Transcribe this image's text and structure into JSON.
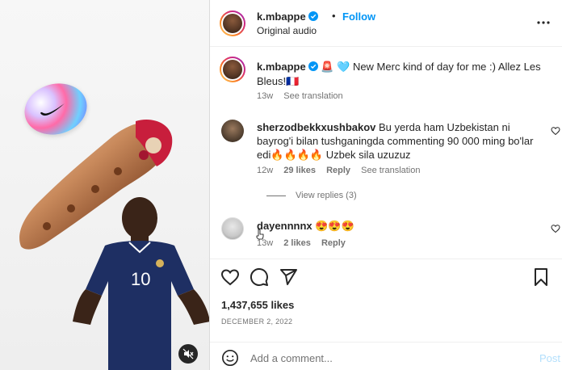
{
  "post": {
    "username": "k.mbappe",
    "follow_label": "Follow",
    "dot": "•",
    "audio_label": "Original audio",
    "more_icon": "more-horizontal-icon",
    "accent_color": "#0095f6"
  },
  "caption": {
    "username": "k.mbappe",
    "emojis": "🚨 🩵",
    "text": "New Merc kind of day for me :) Allez Les Bleus!🇫🇷",
    "age": "13w",
    "see_translation": "See translation"
  },
  "comments": [
    {
      "username": "sherzodbekkxushbakov",
      "text": "Bu yerda ham Uzbekistan ni bayrog'i bilan tushganingda commenting 90 000 ming bo'lar edi🔥🔥🔥🔥 Uzbek sila uzuzuz",
      "age": "12w",
      "likes": "29 likes",
      "reply": "Reply",
      "see_translation": "See translation",
      "view_replies": "View replies (3)"
    },
    {
      "username": "dayennnnx",
      "text": "😍😍😍",
      "age": "13w",
      "likes": "2 likes",
      "reply": "Reply"
    }
  ],
  "actions": {
    "likes": "1,437,655 likes",
    "date": "DECEMBER 2, 2022"
  },
  "composer": {
    "placeholder": "Add a comment...",
    "post_label": "Post"
  }
}
